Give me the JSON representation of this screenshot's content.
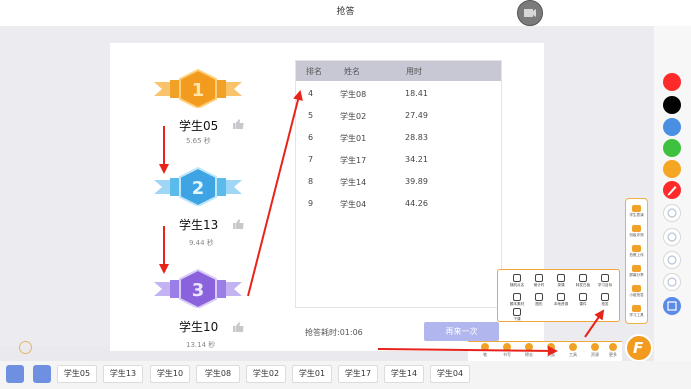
{
  "window": {
    "title": "抢答"
  },
  "podium": [
    {
      "rank_label": "1",
      "name": "学生05",
      "time": "5.65 秒",
      "color": "#f2a128"
    },
    {
      "rank_label": "2",
      "name": "学生13",
      "time": "9.44 秒",
      "color": "#46a9e6"
    },
    {
      "rank_label": "3",
      "name": "学生10",
      "time": "13.14 秒",
      "color": "#8f6ee0"
    }
  ],
  "ranking_table": {
    "headers": [
      "排名",
      "姓名",
      "用时"
    ],
    "rows": [
      {
        "rank": "4",
        "name": "学生08",
        "time": "18.41"
      },
      {
        "rank": "5",
        "name": "学生02",
        "time": "27.49"
      },
      {
        "rank": "6",
        "name": "学生01",
        "time": "28.83"
      },
      {
        "rank": "7",
        "name": "学生17",
        "time": "34.21"
      },
      {
        "rank": "8",
        "name": "学生14",
        "time": "39.89"
      },
      {
        "rank": "9",
        "name": "学生04",
        "time": "44.26"
      }
    ]
  },
  "footer": {
    "elapsed_label": "抢答耗时:01:06",
    "again_label": "再来一次"
  },
  "bottom_chips": [
    "学生05",
    "学生13",
    "学生10",
    "学生08",
    "学生02",
    "学生01",
    "学生17",
    "学生14",
    "学生04"
  ],
  "palette": [
    "#ff2a2a",
    "#000000",
    "#4a90e2",
    "#3ec13e",
    "#f5a623"
  ],
  "side_panel": [
    "学生表演",
    "班级评测",
    "拍照上传",
    "屏幕分享",
    "小组抢答",
    "学习工具"
  ],
  "tools_popup": [
    [
      "随机点名",
      "倒计时",
      "录课",
      "转发白板",
      "学习目标"
    ],
    [
      "题本素材",
      "图形",
      "本地资源",
      "课件",
      "抢答"
    ],
    [
      "下课"
    ]
  ],
  "dock": [
    "笔",
    "书写",
    "擦去",
    "页面",
    "工具",
    "资源",
    "更多"
  ],
  "brand_letter": "F"
}
